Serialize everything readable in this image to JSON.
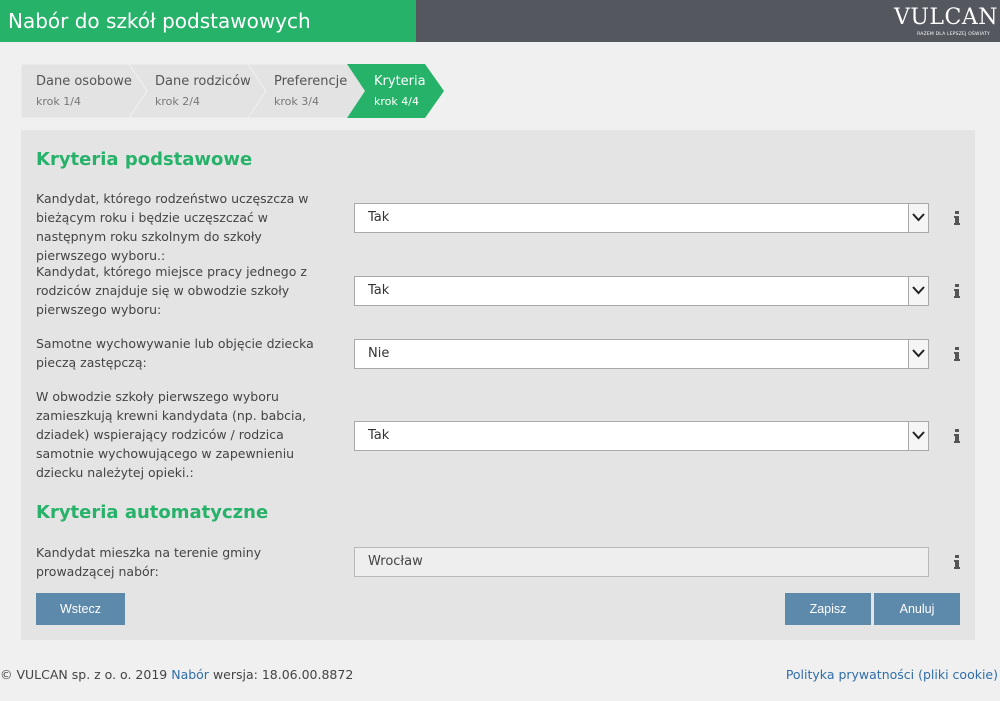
{
  "header": {
    "title": "Nabór do szkół podstawowych",
    "logo_text": "VULCAN",
    "logo_tagline": "RAZEM DLA LEPSZEJ OŚWIATY"
  },
  "steps": [
    {
      "label": "Dane osobowe",
      "sub": "krok 1/4",
      "active": false
    },
    {
      "label": "Dane rodziców",
      "sub": "krok 2/4",
      "active": false
    },
    {
      "label": "Preferencje",
      "sub": "krok 3/4",
      "active": false
    },
    {
      "label": "Kryteria",
      "sub": "krok 4/4",
      "active": true
    }
  ],
  "basic": {
    "title": "Kryteria podstawowe",
    "items": [
      {
        "question": "Kandydat, którego rodzeństwo uczęszcza w bieżącym roku i będzie uczęszczać w następnym roku szkolnym do szkoły pierwszego wyboru.:",
        "value": "Tak"
      },
      {
        "question": "Kandydat, którego miejsce pracy jednego z rodziców znajduje się w obwodzie szkoły pierwszego wyboru:",
        "value": "Tak"
      },
      {
        "question": "Samotne wychowywanie lub objęcie dziecka pieczą zastępczą:",
        "value": "Nie"
      },
      {
        "question": "W obwodzie szkoły pierwszego wyboru zamieszkują krewni kandydata (np. babcia, dziadek) wspierający rodziców / rodzica samotnie wychowującego w zapewnieniu dziecku należytej opieki.:",
        "value": "Tak"
      }
    ]
  },
  "automatic": {
    "title": "Kryteria automatyczne",
    "items": [
      {
        "question": "Kandydat mieszka na terenie gminy prowadzącej nabór:",
        "value": "Wrocław"
      }
    ]
  },
  "buttons": {
    "back": "Wstecz",
    "save": "Zapisz",
    "cancel": "Anuluj"
  },
  "footer": {
    "copyright": "© VULCAN sp. z o. o. 2019",
    "link": "Nabór",
    "version": "wersja: 18.06.00.8872",
    "privacy": "Polityka prywatności (pliki cookie)"
  },
  "colors": {
    "accent": "#27b26a",
    "header_dark": "#55575f",
    "button": "#5d89aa",
    "link": "#2f6ea8"
  }
}
